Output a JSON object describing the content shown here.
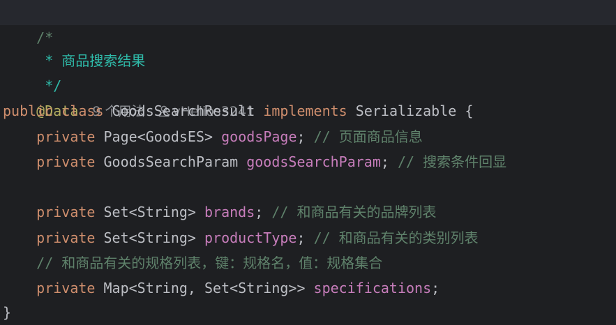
{
  "editor": {
    "lines": [
      {
        "text": "/*"
      },
      {
        "text": " * 商品搜索结果"
      },
      {
        "text": " */"
      },
      {
        "annotation": "@Data",
        "usages": "9 个用法",
        "author": "vHelios3241"
      },
      {
        "kw1": "public",
        "kw2": "class",
        "class_name": "GoodsSearchResult",
        "kw3": "implements",
        "iface": "Serializable",
        "brace": "{"
      },
      {
        "kw": "private",
        "type": "Page<GoodsES>",
        "field": "goodsPage",
        "punct": ";",
        "comment": "// 页面商品信息"
      },
      {
        "kw": "private",
        "type": "GoodsSearchParam",
        "field": "goodsSearchParam",
        "punct": ";",
        "comment": "// 搜索条件回显"
      },
      {
        "text": ""
      },
      {
        "kw": "private",
        "type": "Set<String>",
        "field": "brands",
        "punct": ";",
        "comment": "// 和商品有关的品牌列表"
      },
      {
        "kw": "private",
        "type": "Set<String>",
        "field": "productType",
        "punct": ";",
        "comment": "// 和商品有关的类别列表"
      },
      {
        "comment": "// 和商品有关的规格列表，键：规格名，值：规格集合"
      },
      {
        "kw": "private",
        "type": "Map<String, Set<String>>",
        "field": "specifications",
        "punct": ";"
      },
      {
        "text": "}"
      }
    ]
  },
  "icons": {
    "author": "person-icon"
  }
}
